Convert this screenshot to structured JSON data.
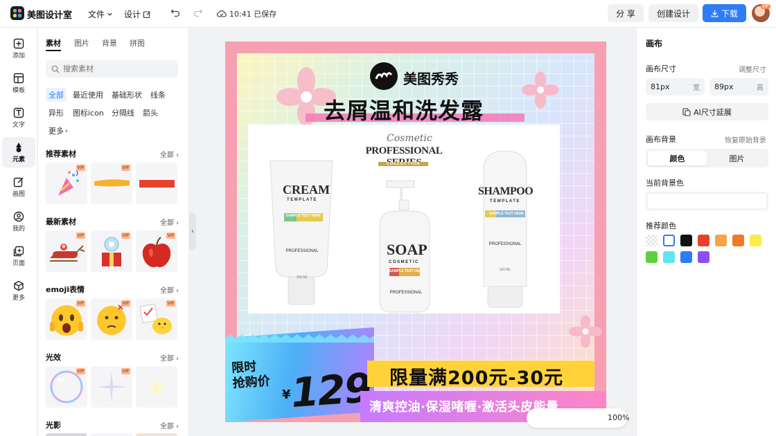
{
  "app": {
    "title": "美图设计室"
  },
  "menu": {
    "file": "文件",
    "design": "设计"
  },
  "status": {
    "save": "10:41 已保存"
  },
  "actions": {
    "share": "分 享",
    "create": "创建设计",
    "download": "下载",
    "user_badge": "VIP"
  },
  "rail": [
    {
      "label": "添加",
      "icon": "plus-square-icon"
    },
    {
      "label": "模板",
      "icon": "template-icon"
    },
    {
      "label": "文字",
      "icon": "text-icon"
    },
    {
      "label": "元素",
      "icon": "elements-icon"
    },
    {
      "label": "画图",
      "icon": "draw-icon"
    },
    {
      "label": "我的",
      "icon": "user-icon"
    },
    {
      "label": "页面",
      "icon": "add-page-icon"
    },
    {
      "label": "更多",
      "icon": "more-cube-icon"
    }
  ],
  "panel": {
    "tabs": [
      "素材",
      "图片",
      "背景",
      "拼图"
    ],
    "search_placeholder": "搜索素材",
    "chips": [
      "全部",
      "最近使用",
      "基础形状",
      "线条",
      "异形",
      "图标icon",
      "分隔线",
      "箭头",
      "更多"
    ],
    "sections": [
      {
        "title": "推荐素材",
        "all": "全部",
        "vip": [
          "VIP",
          "VIP"
        ]
      },
      {
        "title": "最新素材",
        "all": "全部",
        "vip": [
          "VIP",
          "VIP",
          "VIP"
        ]
      },
      {
        "title": "emoji表情",
        "all": "全部",
        "vip": [
          "VIP",
          "VIP",
          "VIP"
        ]
      },
      {
        "title": "光效",
        "all": "全部",
        "vip": [
          "VIP",
          "VIP"
        ]
      },
      {
        "title": "光影",
        "all": "全部"
      }
    ]
  },
  "props": {
    "heading": "画布",
    "size_label": "画布尺寸",
    "size_link": "调整尺寸",
    "width": {
      "value": "81px",
      "unit": "宽"
    },
    "height": {
      "value": "89px",
      "unit": "高"
    },
    "ai_expand": "AI尺寸延展",
    "bg_label": "画布背景",
    "bg_reset": "恢复原始背景",
    "seg": [
      "颜色",
      "图片"
    ],
    "current_color_label": "当前背景色",
    "recommended_label": "推荐颜色",
    "swatches": [
      "transparent",
      "#ffffff",
      "#111111",
      "#e8412a",
      "#f4a548",
      "#f07826",
      "#f7ef45",
      "#5bd13f",
      "#5fe6ef",
      "#2f7cf6",
      "#8b4ff0"
    ]
  },
  "poster": {
    "brand": "美图秀秀",
    "headline": "去屑温和洗发露",
    "products": {
      "series_script": "Cosmetic",
      "series": "PROFESSIONAL SERIES",
      "collection": "COLLECTION",
      "cream": "CREAM",
      "cream_sub": "TEMPLATE",
      "soap": "SOAP",
      "soap_sub": "COSMETIC",
      "shampoo": "SHAMPOO",
      "shampoo_sub": "TEMPLATE",
      "sample": "SAMPLE TEXT HERE",
      "pro": "PROFESSIONAL",
      "volume": "100 ML"
    },
    "limit_line1": "限时",
    "limit_line2": "抢购价",
    "currency": "¥",
    "price": "129",
    "promo": "限量满200元-30元",
    "sub": "清爽控油·保湿啫喱·激活头皮能量"
  },
  "zoom": {
    "value": "100%"
  }
}
